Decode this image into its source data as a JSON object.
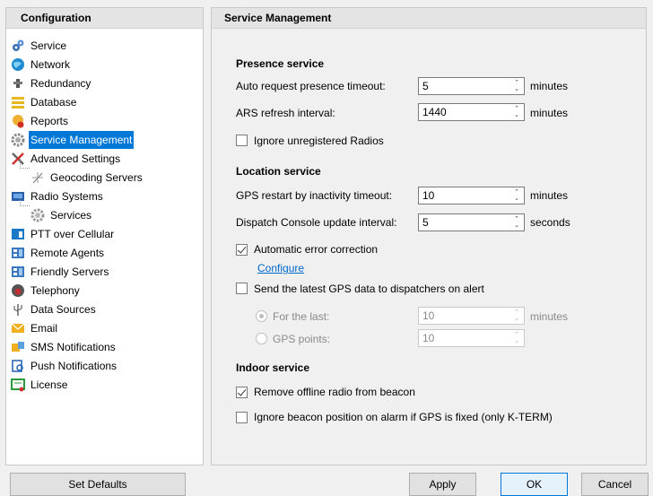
{
  "left_panel": {
    "title": "Configuration",
    "items": [
      {
        "label": "Service",
        "icon": "service-icon"
      },
      {
        "label": "Network",
        "icon": "network-icon"
      },
      {
        "label": "Redundancy",
        "icon": "redundancy-icon"
      },
      {
        "label": "Database",
        "icon": "database-icon"
      },
      {
        "label": "Reports",
        "icon": "reports-icon"
      },
      {
        "label": "Service Management",
        "icon": "gear-icon",
        "selected": true
      },
      {
        "label": "Advanced Settings",
        "icon": "tools-icon"
      },
      {
        "label": "Geocoding Servers",
        "icon": "geocoding-icon",
        "child": true
      },
      {
        "label": "Radio Systems",
        "icon": "radio-systems-icon"
      },
      {
        "label": "Services",
        "icon": "gear-icon",
        "child": true
      },
      {
        "label": "PTT over Cellular",
        "icon": "ptt-icon"
      },
      {
        "label": "Remote Agents",
        "icon": "remote-agents-icon"
      },
      {
        "label": "Friendly Servers",
        "icon": "friendly-servers-icon"
      },
      {
        "label": "Telephony",
        "icon": "telephone-icon"
      },
      {
        "label": "Data Sources",
        "icon": "data-sources-icon"
      },
      {
        "label": "Email",
        "icon": "email-icon"
      },
      {
        "label": "SMS Notifications",
        "icon": "sms-icon"
      },
      {
        "label": "Push Notifications",
        "icon": "push-icon"
      },
      {
        "label": "License",
        "icon": "license-icon"
      }
    ]
  },
  "right_panel": {
    "title": "Service Management",
    "presence": {
      "title": "Presence service",
      "auto_request_label": "Auto request presence timeout:",
      "auto_request_value": "5",
      "auto_request_unit": "minutes",
      "ars_label": "ARS refresh interval:",
      "ars_value": "1440",
      "ars_unit": "minutes",
      "ignore_unregistered_label": "Ignore unregistered Radios",
      "ignore_unregistered_checked": false
    },
    "location": {
      "title": "Location service",
      "gps_restart_label": "GPS restart by inactivity timeout:",
      "gps_restart_value": "10",
      "gps_restart_unit": "minutes",
      "dispatch_label": "Dispatch Console update interval:",
      "dispatch_value": "5",
      "dispatch_unit": "seconds",
      "auto_error_label": "Automatic error correction",
      "auto_error_checked": true,
      "configure_link": "Configure",
      "send_latest_label": "Send the latest GPS data to dispatchers on alert",
      "send_latest_checked": false,
      "for_last_label": "For the last:",
      "for_last_value": "10",
      "for_last_unit": "minutes",
      "gps_points_label": "GPS points:",
      "gps_points_value": "10"
    },
    "indoor": {
      "title": "Indoor service",
      "remove_offline_label": "Remove offline radio from beacon",
      "remove_offline_checked": true,
      "ignore_beacon_label": "Ignore beacon position on alarm if GPS is fixed (only K-TERM)",
      "ignore_beacon_checked": false
    }
  },
  "buttons": {
    "set_defaults": "Set Defaults",
    "apply": "Apply",
    "ok": "OK",
    "cancel": "Cancel"
  },
  "colors": {
    "selection": "#0078d7",
    "link": "#0066cc",
    "panel_header": "#e4e4e4"
  }
}
